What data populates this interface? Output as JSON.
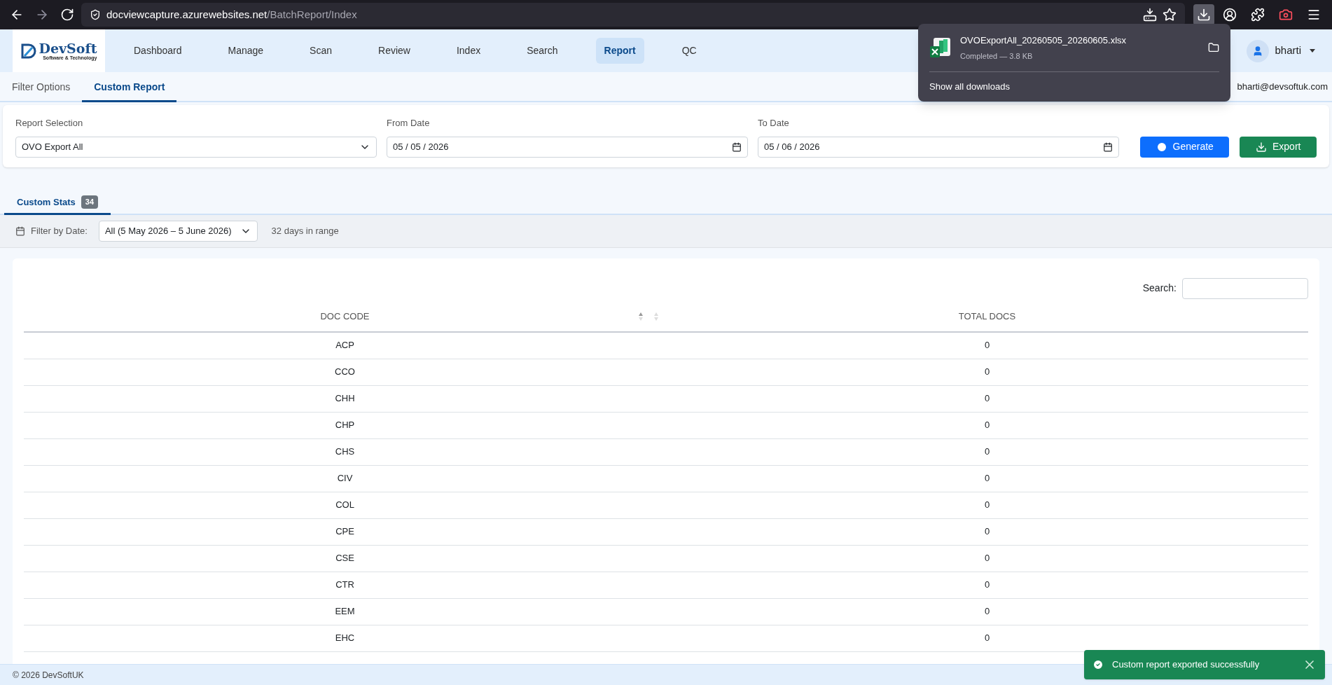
{
  "browser": {
    "url_host": "docviewcapture.azurewebsites.net",
    "url_path": "/BatchReport/Index"
  },
  "downloads_panel": {
    "file_name": "OVOExportAll_20260505_20260605.xlsx",
    "status": "Completed — 3.8 KB",
    "show_all": "Show all downloads"
  },
  "nav": {
    "logo_name": "DevSoft",
    "logo_tagline": "Software & Technology",
    "items": [
      {
        "label": "Dashboard",
        "selected": false
      },
      {
        "label": "Manage",
        "selected": false
      },
      {
        "label": "Scan",
        "selected": false
      },
      {
        "label": "Review",
        "selected": false
      },
      {
        "label": "Index",
        "selected": false
      },
      {
        "label": "Search",
        "selected": false
      },
      {
        "label": "Report",
        "selected": true
      },
      {
        "label": "QC",
        "selected": false
      }
    ],
    "user": "bharti",
    "email": "bharti@devsoftuk.com"
  },
  "sub_tabs": [
    {
      "label": "Filter Options",
      "selected": false
    },
    {
      "label": "Custom Report",
      "selected": true
    }
  ],
  "form": {
    "report_label": "Report Selection",
    "report_value": "OVO Export All",
    "from_label": "From Date",
    "from_value": "05 / 05 / 2026",
    "to_label": "To Date",
    "to_value": "05 / 06 / 2026",
    "generate": "Generate",
    "export": "Export"
  },
  "stats_tab": {
    "label": "Custom Stats",
    "count": "34",
    "selected": true
  },
  "filter": {
    "label": "Filter by Date:",
    "value": "All (5 May 2026 – 5 June 2026)",
    "note": "32 days in range"
  },
  "table": {
    "search_label": "Search:",
    "columns": [
      "DOC CODE",
      "TOTAL DOCS"
    ],
    "rows": [
      [
        "ACP",
        "0"
      ],
      [
        "CCO",
        "0"
      ],
      [
        "CHH",
        "0"
      ],
      [
        "CHP",
        "0"
      ],
      [
        "CHS",
        "0"
      ],
      [
        "CIV",
        "0"
      ],
      [
        "COL",
        "0"
      ],
      [
        "CPE",
        "0"
      ],
      [
        "CSE",
        "0"
      ],
      [
        "CTR",
        "0"
      ],
      [
        "EEM",
        "0"
      ],
      [
        "EHC",
        "0"
      ]
    ]
  },
  "footer": {
    "copyright": "© 2026 DevSoftUK"
  },
  "toast": {
    "message": "Custom report exported successfully"
  }
}
